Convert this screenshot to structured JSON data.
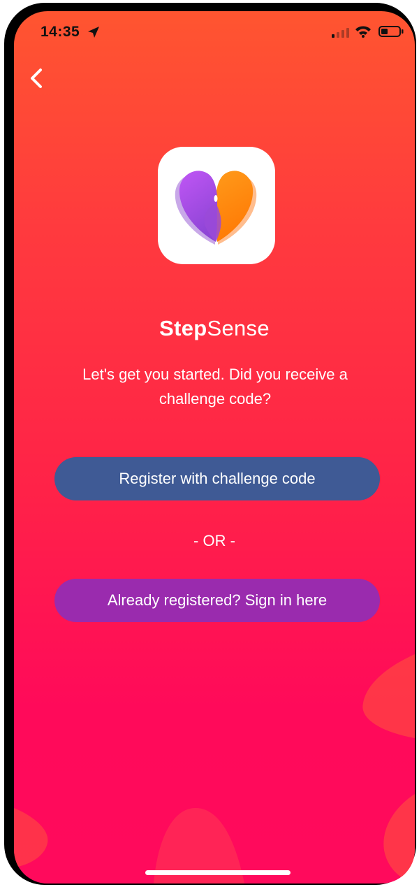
{
  "status_bar": {
    "time": "14:35",
    "icons": [
      "location-arrow-icon",
      "cellular-signal-icon",
      "wifi-icon",
      "battery-icon"
    ]
  },
  "nav": {
    "back_icon": "chevron-left-icon"
  },
  "brand": {
    "name_bold": "Step",
    "name_light": "Sense",
    "logo_icon": "heart-logo-icon"
  },
  "intro": {
    "text": "Let's get you started. Did you receive a challenge code?"
  },
  "actions": {
    "register_label": "Register with challenge code",
    "divider_label": "- OR -",
    "signin_label": "Already registered? Sign in here"
  },
  "colors": {
    "background_top": "#ff5530",
    "background_bottom": "#ff0a5c",
    "register_button": "#3f5a95",
    "signin_button": "#9a2bae",
    "logo_purple": "#b04ff0",
    "logo_orange": "#ff8a0a"
  }
}
